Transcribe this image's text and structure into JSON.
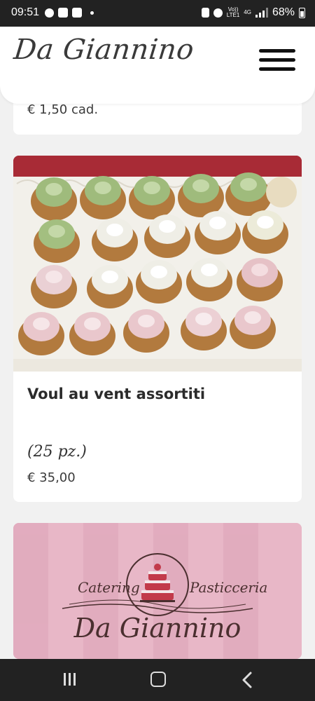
{
  "status_bar": {
    "time": "09:51",
    "network_top": "Vo))",
    "network_bottom": "LTE1",
    "network_type": "4G",
    "battery": "68%"
  },
  "header": {
    "logo_text": "Da Giannino",
    "menu_icon": "hamburger-menu-icon"
  },
  "products": [
    {
      "price": "€ 1,50 cad."
    },
    {
      "title": "Voul au vent assortiti",
      "quantity": "(25 pz.)",
      "price": "€ 35,00",
      "image": "tray of assorted vol-au-vents with green, white and pink cream"
    }
  ],
  "promo": {
    "left_text": "Catering",
    "right_text": "Pasticceria",
    "brand": "Da Giannino",
    "icon": "cake-icon"
  },
  "nav_bar": {
    "recents_icon": "recents-icon",
    "home_icon": "home-icon",
    "back_icon": "back-icon"
  },
  "colors": {
    "background": "#f1f1f1",
    "status_bar": "#222222",
    "promo_pink": "#e8b7c7",
    "brand_brown": "#4a2f2f"
  }
}
